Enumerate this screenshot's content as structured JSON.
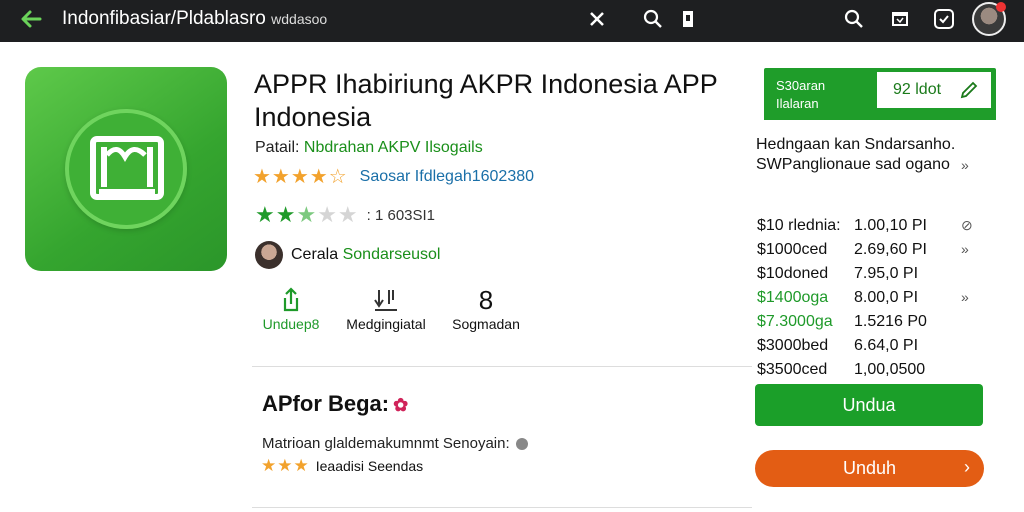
{
  "topbar": {
    "title": "Indonfibasiar/Pldablasro",
    "title_small": "wddasoo",
    "icons": [
      "back-arrow-icon",
      "close-icon",
      "search-icon",
      "bookmark-icon",
      "search-icon",
      "share-icon",
      "badge-icon",
      "avatar"
    ]
  },
  "app": {
    "title": "APPR Ihabiriung AKPR Indonesia APP Indonesia",
    "publisher_label": "Patail:",
    "publisher_link": "Nbdrahan AKPV Ilsogails",
    "stars_1": "★★★★☆",
    "stat_1": "Saosar Ifdlegah1602380",
    "stars_2_filled": "★★",
    "stars_2_half": "★",
    "stars_2_empty": "★★",
    "rating_count": ": 1 603SI1",
    "developer_label": "Cerala",
    "developer_name": "Sondarseusol"
  },
  "actions": [
    {
      "icon": "share-icon",
      "label": "Unduep8"
    },
    {
      "icon": "download-icon",
      "label": "Medgingiatal"
    },
    {
      "icon": "number-icon",
      "label": "Sogmadan",
      "glyph": "8"
    }
  ],
  "download_box": {
    "label_line1": "S30aran",
    "label_line2": "Ilalaran",
    "value": "92 ldot"
  },
  "pricing": {
    "header_line1": "Hedngaan kan Sndarsanho.",
    "header_line2": "SWPanglionaue sad ogano",
    "rows": [
      {
        "a": "$10 rlednia:",
        "b": "1.00,10 PI",
        "c": "⊘",
        "green": false
      },
      {
        "a": "$1000ced",
        "b": "2.69,60 PI",
        "c": "»",
        "green": false
      },
      {
        "a": "$10doned",
        "b": "7.95,0 PI",
        "c": "",
        "green": false
      },
      {
        "a": "$1400oga",
        "b": "8.00,0 PI",
        "c": "»",
        "green": true
      },
      {
        "a": "$7.3000ga",
        "b": "1.5216 P0",
        "c": "",
        "green": true
      },
      {
        "a": "$3000bed",
        "b": "6.64,0 PI",
        "c": "",
        "green": false
      },
      {
        "a": "$3500ced",
        "b": "1,00,0500",
        "c": "",
        "green": false
      }
    ]
  },
  "section": {
    "title": "APfor Begа:",
    "description": "Matrioan glaldemakumnmt Senoyain:",
    "rating_text": "Ieaadisi Seendas",
    "stars": "★★★"
  },
  "buttons": {
    "green": "Undua",
    "orange": "Unduh"
  },
  "colors": {
    "topbar": "#1e1f21",
    "green": "#1f9d2a",
    "orange": "#e35d14",
    "star": "#f2a22d"
  }
}
